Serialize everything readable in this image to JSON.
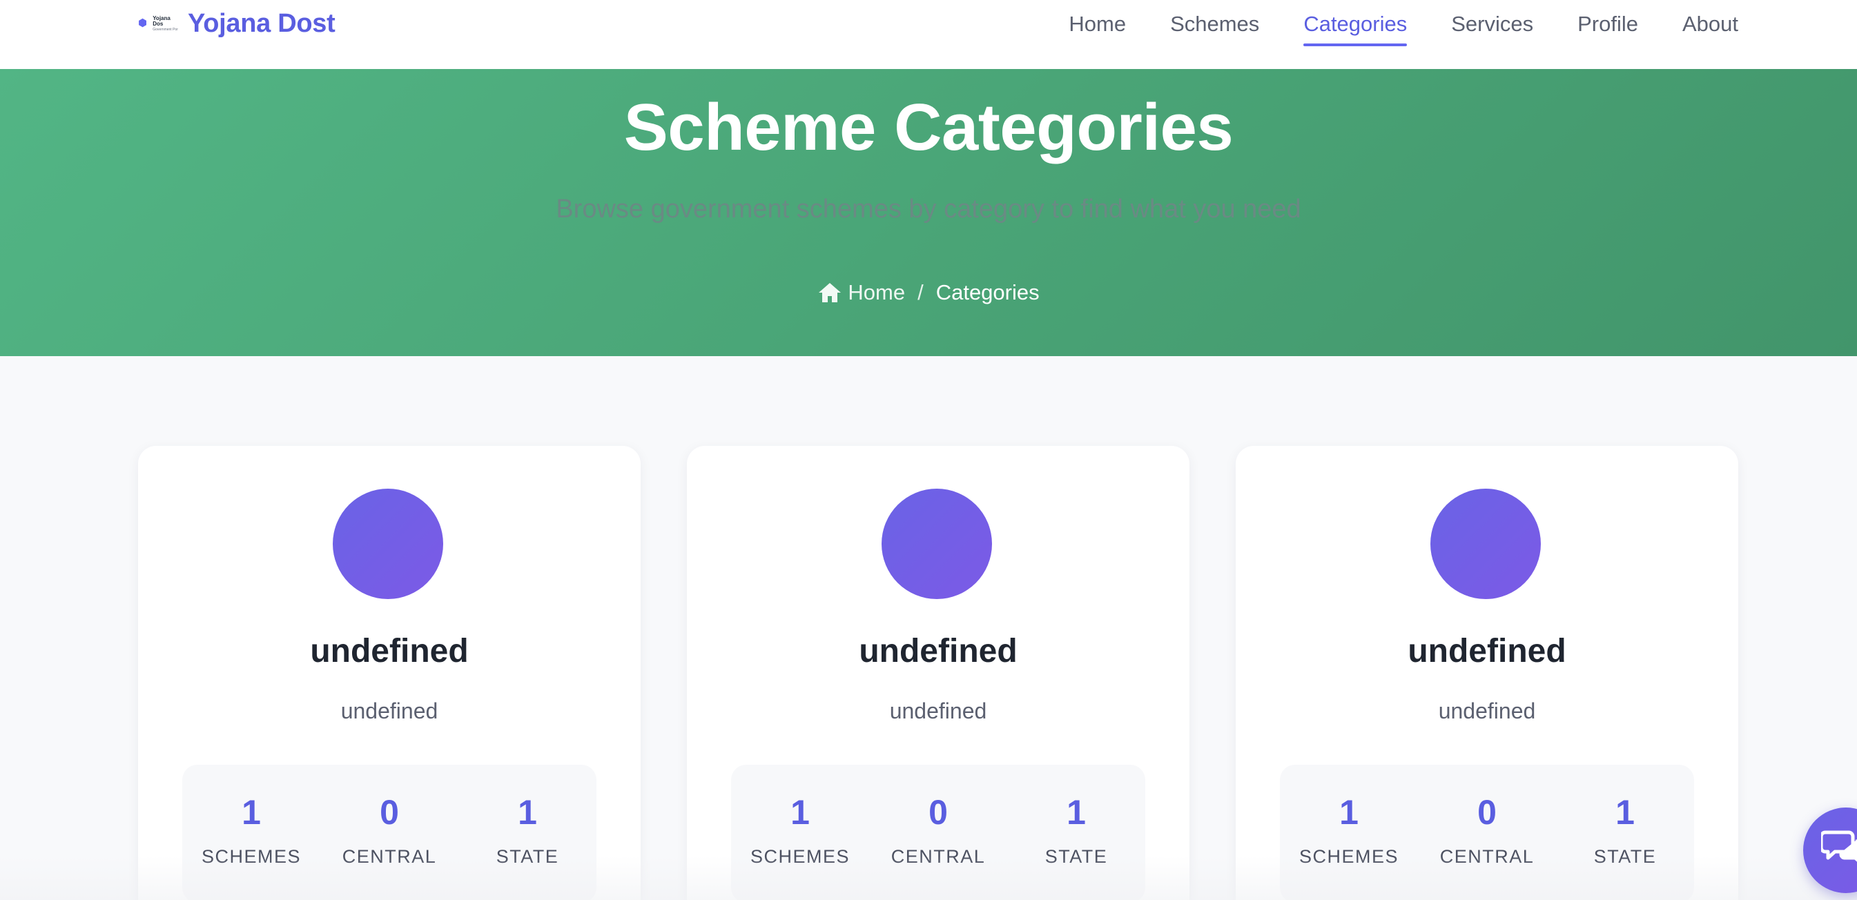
{
  "brand": {
    "logo_text": "Yojana Dos",
    "logo_subtext": "Government Por",
    "name": "Yojana Dost"
  },
  "nav": {
    "items": [
      {
        "label": "Home",
        "active": false
      },
      {
        "label": "Schemes",
        "active": false
      },
      {
        "label": "Categories",
        "active": true
      },
      {
        "label": "Services",
        "active": false
      },
      {
        "label": "Profile",
        "active": false
      },
      {
        "label": "About",
        "active": false
      }
    ]
  },
  "hero": {
    "title": "Scheme Categories",
    "subtitle": "Browse government schemes by category to find what you need",
    "breadcrumb": {
      "home_label": "Home",
      "separator": "/",
      "current": "Categories"
    }
  },
  "categories": [
    {
      "name": "undefined",
      "description": "undefined",
      "stats": [
        {
          "value": "1",
          "label": "SCHEMES"
        },
        {
          "value": "0",
          "label": "CENTRAL"
        },
        {
          "value": "1",
          "label": "STATE"
        }
      ]
    },
    {
      "name": "undefined",
      "description": "undefined",
      "stats": [
        {
          "value": "1",
          "label": "SCHEMES"
        },
        {
          "value": "0",
          "label": "CENTRAL"
        },
        {
          "value": "1",
          "label": "STATE"
        }
      ]
    },
    {
      "name": "undefined",
      "description": "undefined",
      "stats": [
        {
          "value": "1",
          "label": "SCHEMES"
        },
        {
          "value": "0",
          "label": "CENTRAL"
        },
        {
          "value": "1",
          "label": "STATE"
        }
      ]
    }
  ],
  "colors": {
    "primary": "#5a5ee0",
    "hero_green": "#4aa577",
    "circle_gradient_start": "#6a63e6",
    "circle_gradient_end": "#7c5ae6"
  },
  "icons": {
    "logo": "hexagon-logo-icon",
    "breadcrumb_home": "home-icon",
    "chat": "chat-bubble-icon"
  }
}
